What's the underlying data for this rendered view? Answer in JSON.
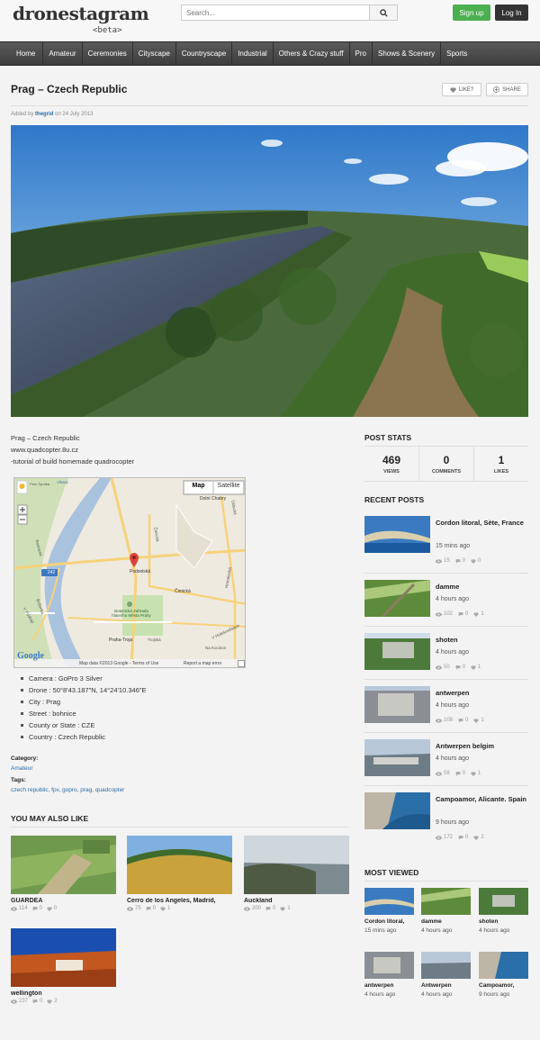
{
  "header": {
    "logo": "dronestagram",
    "logo_sub": "<beta>",
    "search_placeholder": "Search...",
    "signup": "Sign up",
    "login": "Log In"
  },
  "nav": [
    "Home",
    "Amateur",
    "Ceremonies",
    "Cityscape",
    "Countryscape",
    "Industrial",
    "Others & Crazy stuff",
    "Pro",
    "Shows & Scenery",
    "Sports"
  ],
  "post": {
    "title": "Prag – Czech Republic",
    "like": "LIKE?",
    "share": "SHARE",
    "added_by_prefix": "Added by",
    "author": "thegrid",
    "date_prefix": "on",
    "date": "24 July 2013",
    "description": [
      "Prag – Czech Republic",
      "www.quadcopter.8u.cz",
      "-tutorial of build homemade quadrocopter"
    ],
    "specs": [
      "Camera : GoPro 3 Silver",
      "Drone : 50°8'43.187\"N, 14°24'10.346\"E",
      "City : Prag",
      "Street : bohnice",
      "County or State : CZE",
      "Country : Czech Republic"
    ],
    "category_label": "Category:",
    "category": "Amateur",
    "tags_label": "Tags:",
    "tags": "czech republic, fpv, gopro, prag, quadcopter"
  },
  "map": {
    "map_btn": "Map",
    "satellite_btn": "Satellite",
    "footer": "Map data ©2013 Google - Terms of Use",
    "report": "Report a map error",
    "logo": "Google",
    "labels": {
      "dolni_chabry": "Dolní Chabry",
      "podzelska": "Podzelská",
      "botanicka": "Botanická Zahrada hlavního Města Prahy",
      "praha_troja": "Praha-Troja",
      "trojska": "Trojská",
      "cimicka": "Čimická",
      "vltava": "Vltava",
      "route": "242",
      "pelc_tyrolka": "Pelc-Tyrolka",
      "v_holesovickach": "V Holešovičkách",
      "rosnicka": "Rosnická",
      "bozenka": "Boženka",
      "v_podhaji": "V Podhájí",
      "cimicka_2": "Čimická",
      "hornatecka": "Hornátecká",
      "ustecka": "Ústecká",
      "na_kocince": "Na Kocince"
    }
  },
  "you_may_also_like": {
    "heading": "YOU MAY ALSO LIKE",
    "items": [
      {
        "title": "GUARDEA",
        "views": "114",
        "comments": "0",
        "likes": "0"
      },
      {
        "title": "Cerro de los Angeles, Madrid,",
        "views": "75",
        "comments": "0",
        "likes": "1"
      },
      {
        "title": "Auckland",
        "views": "200",
        "comments": "0",
        "likes": "1"
      },
      {
        "title": "wellington",
        "views": "237",
        "comments": "0",
        "likes": "2"
      }
    ]
  },
  "post_stats": {
    "heading": "POST STATS",
    "views": "469",
    "views_label": "VIEWS",
    "comments": "0",
    "comments_label": "COMMENTS",
    "likes": "1",
    "likes_label": "LIKES"
  },
  "recent_posts": {
    "heading": "RECENT POSTS",
    "items": [
      {
        "title": "Cordon litoral, Sète, France",
        "time": "15 mins ago",
        "views": "15",
        "comments": "0",
        "likes": "0"
      },
      {
        "title": "damme",
        "time": "4 hours ago",
        "views": "102",
        "comments": "0",
        "likes": "1"
      },
      {
        "title": "shoten",
        "time": "4 hours ago",
        "views": "50",
        "comments": "0",
        "likes": "1"
      },
      {
        "title": "antwerpen",
        "time": "4 hours ago",
        "views": "108",
        "comments": "0",
        "likes": "1"
      },
      {
        "title": "Antwerpen belgim",
        "time": "4 hours ago",
        "views": "58",
        "comments": "0",
        "likes": "1"
      },
      {
        "title": "Campoamor, Alicante. Spain",
        "time": "9 hours ago",
        "views": "172",
        "comments": "0",
        "likes": "2"
      }
    ]
  },
  "most_viewed": {
    "heading": "MOST VIEWED",
    "items": [
      {
        "title": "Cordon litoral,",
        "time": "15 mins ago"
      },
      {
        "title": "damme",
        "time": "4 hours ago"
      },
      {
        "title": "shoten",
        "time": "4 hours ago"
      },
      {
        "title": "antwerpen",
        "time": "4 hours ago"
      },
      {
        "title": "Antwerpen",
        "time": "4 hours ago"
      },
      {
        "title": "Campoamor,",
        "time": "9 hours ago"
      }
    ]
  },
  "colors": {
    "signup": "#4caf50",
    "login": "#333333",
    "nav": "#4a4a4a",
    "link": "#2a6ea6"
  }
}
